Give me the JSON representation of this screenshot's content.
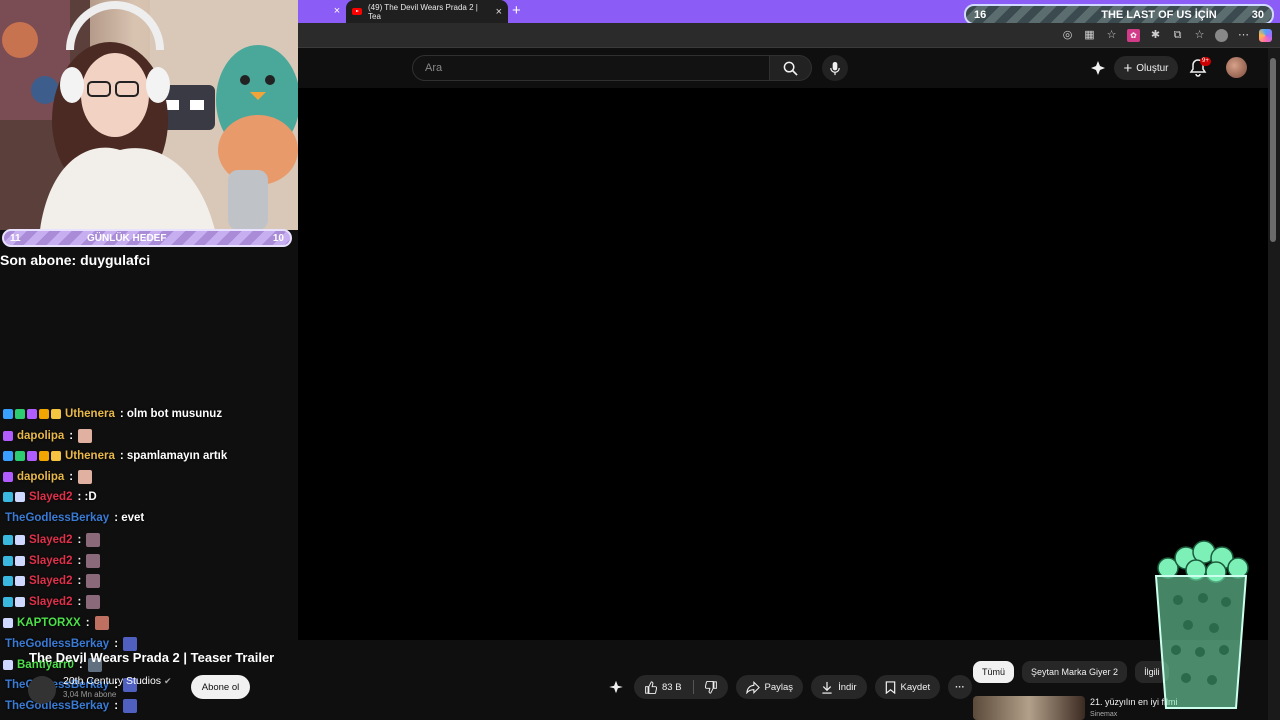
{
  "browser": {
    "tab_title": "(49) The Devil Wears Prada 2 | Tea",
    "tab_close": "×",
    "new_tab": "+",
    "window_controls": [
      "—",
      "▢",
      "✕"
    ]
  },
  "stream_overlay": {
    "top_goal": {
      "left_value": "16",
      "title": "THE LAST OF US İÇİN",
      "right_value": "30"
    },
    "daily_goal": {
      "left_value": "11",
      "title": "GÜNLÜK HEDEF",
      "right_value": "10"
    },
    "last_sub": "Son abone: duygulafci",
    "colors": {
      "goal_purple": "#a98bd8",
      "tab_strip": "#8b5cf6"
    }
  },
  "youtube_header": {
    "search_placeholder": "Ara",
    "create_label": "Oluştur",
    "notif_badge": "9+"
  },
  "chat": [
    {
      "user": "Uthenera",
      "color": "#e8b84a",
      "msg": ": olm bot musunuz",
      "badges": [
        "#3aa0ff",
        "#2ecc71",
        "#b15cff",
        "#f0a500",
        "#f5c542"
      ]
    },
    {
      "user": "dapolipa",
      "color": "#e8b84a",
      "msg": ":",
      "badges": [
        "#b15cff"
      ],
      "emote": "#e0b0a0"
    },
    {
      "user": "Uthenera",
      "color": "#e8b84a",
      "msg": ": spamlamayın artık",
      "badges": [
        "#3aa0ff",
        "#2ecc71",
        "#b15cff",
        "#f0a500",
        "#f5c542"
      ]
    },
    {
      "user": "dapolipa",
      "color": "#e8b84a",
      "msg": ":",
      "badges": [
        "#b15cff"
      ],
      "emote": "#e0b0a0"
    },
    {
      "user": "Slayed2",
      "color": "#e0304a",
      "msg": ": :D",
      "badges": [
        "#3ab8e0",
        "#cfd8ff"
      ]
    },
    {
      "user": "TheGodlessBerkay",
      "color": "#3a7bd5",
      "msg": ": evet",
      "badges": []
    },
    {
      "user": "Slayed2",
      "color": "#e0304a",
      "msg": ":",
      "badges": [
        "#3ab8e0",
        "#cfd8ff"
      ],
      "emote": "#8a6a7a"
    },
    {
      "user": "Slayed2",
      "color": "#e0304a",
      "msg": ":",
      "badges": [
        "#3ab8e0",
        "#cfd8ff"
      ],
      "emote": "#8a6a7a"
    },
    {
      "user": "Slayed2",
      "color": "#e0304a",
      "msg": ":",
      "badges": [
        "#3ab8e0",
        "#cfd8ff"
      ],
      "emote": "#8a6a7a"
    },
    {
      "user": "Slayed2",
      "color": "#e0304a",
      "msg": ":",
      "badges": [
        "#3ab8e0",
        "#cfd8ff"
      ],
      "emote": "#8a6a7a"
    },
    {
      "user": "KAPTORXX",
      "color": "#4de04a",
      "msg": ":",
      "badges": [
        "#cfd8ff"
      ],
      "emote": "#c07060"
    },
    {
      "user": "TheGodlessBerkay",
      "color": "#3a7bd5",
      "msg": ":",
      "badges": [],
      "emote": "#5060c0"
    },
    {
      "user": "Bahtiyarr0",
      "color": "#4de04a",
      "msg": ":",
      "badges": [
        "#cfd8ff"
      ],
      "emote": "#607080"
    },
    {
      "user": "TheGodlessBerkay",
      "color": "#3a7bd5",
      "msg": ":",
      "badges": [],
      "emote": "#5060c0"
    },
    {
      "user": "TheGodlessBerkay",
      "color": "#3a7bd5",
      "msg": ":",
      "badges": [],
      "emote": "#5060c0"
    }
  ],
  "video": {
    "title": "The Devil Wears Prada 2 | Teaser Trailer",
    "channel": "20th Century Studios",
    "subscribers": "3,04 Mn abone",
    "subscribe_label": "Abone ol",
    "likes": "83 B",
    "share_label": "Paylaş",
    "download_label": "İndir",
    "save_label": "Kaydet",
    "more_label": "···"
  },
  "recommendations": {
    "chips": [
      "Tümü",
      "Şeytan Marka Giyer 2",
      "İlgili"
    ],
    "first_title": "21. yüzyılın en iyi filmi",
    "first_sub": "Sinemax"
  }
}
